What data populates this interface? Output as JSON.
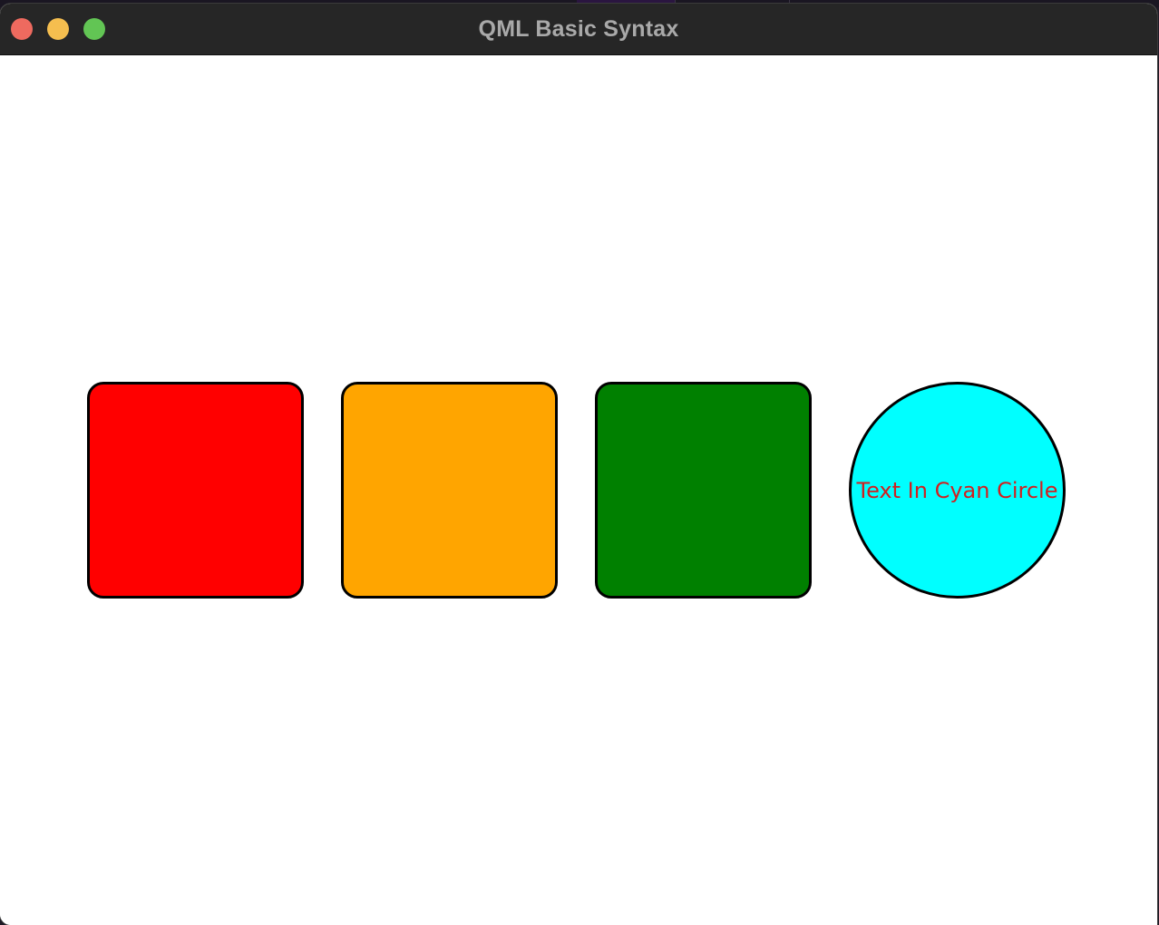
{
  "window": {
    "title": "QML Basic Syntax",
    "traffic_lights": {
      "close_color": "#ee6a5f",
      "minimize_color": "#f5be4f",
      "zoom_color": "#62c554"
    }
  },
  "shapes": [
    {
      "kind": "rounded-rectangle",
      "fill": "#ff0000",
      "border": "#000000"
    },
    {
      "kind": "rounded-rectangle",
      "fill": "#ffa500",
      "border": "#000000"
    },
    {
      "kind": "rounded-rectangle",
      "fill": "#008000",
      "border": "#000000"
    },
    {
      "kind": "circle",
      "fill": "#00ffff",
      "border": "#000000",
      "text": "Text In Cyan Circle",
      "text_color": "#d02020"
    }
  ]
}
